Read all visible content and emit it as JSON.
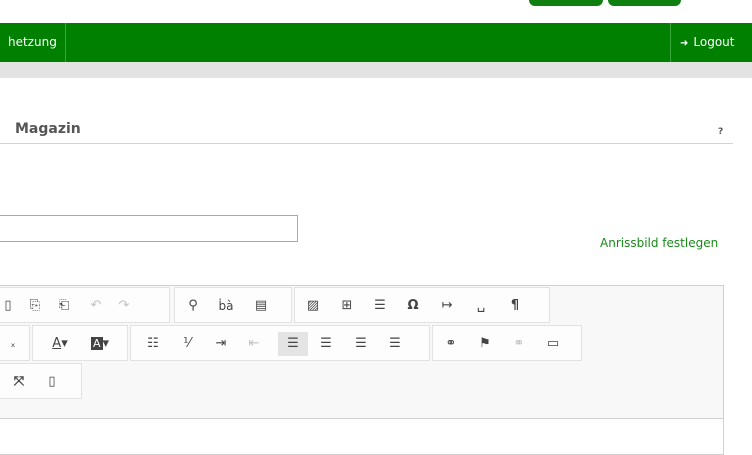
{
  "nav": {
    "partial_item_label": "hetzung",
    "logout_label": "Logout",
    "logout_icon": "sign-out-icon"
  },
  "section": {
    "title": "Magazin",
    "help_label": "?"
  },
  "form": {
    "text_input_value": "",
    "anrissbild_link": "Anrissbild festlegen"
  },
  "toolbar": {
    "row1": [
      {
        "name": "paste-icon",
        "glyph": "🗐"
      },
      {
        "name": "paste-text-icon",
        "glyph": "📋"
      },
      {
        "name": "paste-word-icon",
        "glyph": "📋"
      },
      {
        "name": "undo-icon",
        "glyph": "↶"
      },
      {
        "name": "redo-icon",
        "glyph": "↷"
      },
      {
        "name": "find-icon",
        "glyph": "🔍"
      },
      {
        "name": "replace-icon",
        "glyph": "ᵇa"
      },
      {
        "name": "select-all-icon",
        "glyph": "▤"
      },
      {
        "name": "image-icon",
        "glyph": "🖼"
      },
      {
        "name": "table-icon",
        "glyph": "⊞"
      },
      {
        "name": "horizontal-line-icon",
        "glyph": "≡"
      },
      {
        "name": "special-char-icon",
        "glyph": "Ω"
      },
      {
        "name": "page-break-icon",
        "glyph": "↦"
      },
      {
        "name": "nbsp-icon",
        "glyph": "␣"
      },
      {
        "name": "show-blocks-icon",
        "glyph": "¶"
      }
    ],
    "row2": [
      {
        "name": "remove-format-icon",
        "glyph": "ₓ"
      },
      {
        "name": "text-color-icon",
        "glyph": "A▾"
      },
      {
        "name": "bg-color-icon",
        "glyph": "A▾"
      },
      {
        "name": "bulleted-list-icon",
        "glyph": "☰"
      },
      {
        "name": "numbered-list-icon",
        "glyph": "☷"
      },
      {
        "name": "indent-icon",
        "glyph": "⇥"
      },
      {
        "name": "outdent-icon",
        "glyph": "⇤"
      },
      {
        "name": "align-left-icon",
        "glyph": "≡"
      },
      {
        "name": "align-center-icon",
        "glyph": "≡"
      },
      {
        "name": "align-right-icon",
        "glyph": "≡"
      },
      {
        "name": "justify-icon",
        "glyph": "≡"
      },
      {
        "name": "link-icon",
        "glyph": "⛓"
      },
      {
        "name": "anchor-icon",
        "glyph": "⚑"
      },
      {
        "name": "unlink-icon",
        "glyph": "⛓"
      },
      {
        "name": "glossary-icon",
        "glyph": "📖"
      }
    ],
    "row3": [
      {
        "name": "maximize-icon",
        "glyph": "⤢"
      },
      {
        "name": "source-icon",
        "glyph": "▯"
      }
    ]
  }
}
